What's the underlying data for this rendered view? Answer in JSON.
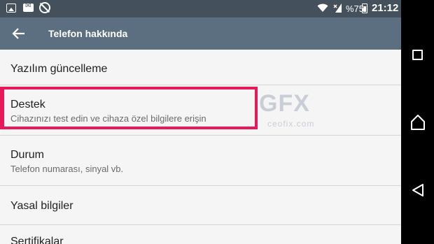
{
  "status_bar": {
    "battery": "%75",
    "time": "21:12",
    "icons": [
      "photo-icon",
      "message-icon",
      "sync-off-icon",
      "wifi-icon",
      "signal-icon",
      "battery-icon"
    ]
  },
  "toolbar": {
    "title": "Telefon hakkında",
    "back_icon": "arrow-back-icon",
    "color": "#5b6f80"
  },
  "settings": {
    "items": [
      {
        "title": "Yazılım güncelleme"
      },
      {
        "title": "Destek",
        "subtitle": "Cihazınızı test edin ve cihaza özel bilgilere erişin",
        "highlighted": true
      },
      {
        "title": "Durum",
        "subtitle": "Telefon numarası, sinyal vb."
      },
      {
        "title": "Yasal bilgiler"
      },
      {
        "title": "Sertifikalar"
      }
    ]
  },
  "watermark": {
    "logo": "GFX",
    "domain": "ceofix.com"
  },
  "highlight_color": "#e8195a",
  "nav_bar": {
    "icons": [
      "recents-icon",
      "home-icon",
      "back-triangle-icon"
    ]
  }
}
